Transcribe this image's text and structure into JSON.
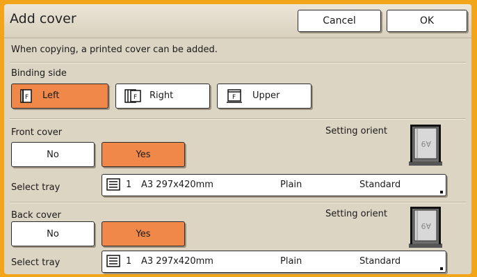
{
  "header": {
    "title": "Add cover",
    "cancel_label": "Cancel",
    "ok_label": "OK"
  },
  "info_text": "When copying, a printed cover can be added.",
  "binding": {
    "label": "Binding side",
    "options": [
      {
        "label": "Left",
        "selected": true,
        "icon": "left-binding-icon"
      },
      {
        "label": "Right",
        "selected": false,
        "icon": "right-binding-icon"
      },
      {
        "label": "Upper",
        "selected": false,
        "icon": "upper-binding-icon"
      }
    ]
  },
  "front": {
    "label": "Front cover",
    "no_label": "No",
    "yes_label": "Yes",
    "selected": "Yes",
    "orient_label": "Setting orient",
    "tray_label": "Select tray",
    "tray": {
      "number": "1",
      "size": "A3 297x420mm",
      "type": "Plain",
      "weight": "Standard"
    }
  },
  "back": {
    "label": "Back cover",
    "no_label": "No",
    "yes_label": "Yes",
    "selected": "Yes",
    "orient_label": "Setting orient",
    "tray_label": "Select tray",
    "tray": {
      "number": "1",
      "size": "A3 297x420mm",
      "type": "Plain",
      "weight": "Standard"
    }
  },
  "colors": {
    "frame": "#f2a51a",
    "panel": "#ddd5c4",
    "selected": "#f0884a"
  }
}
